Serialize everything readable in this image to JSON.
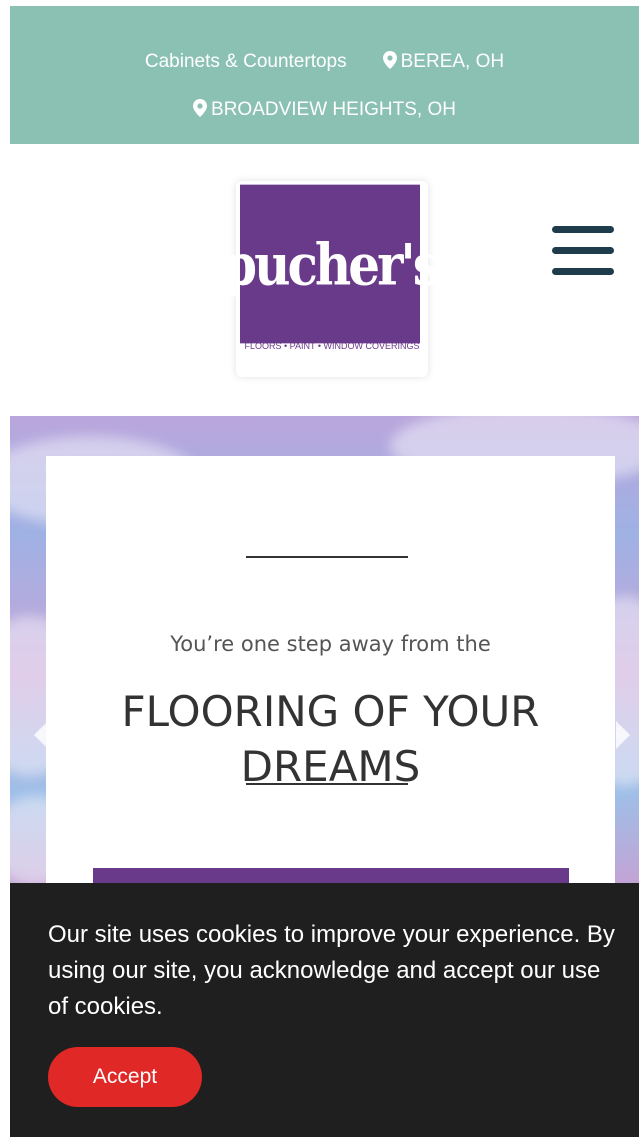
{
  "topbar": {
    "service_link": "Cabinets & Countertops",
    "location1": "BEREA, OH",
    "location2": "BROADVIEW HEIGHTS, OH",
    "background_color": "#8ac1b2"
  },
  "header": {
    "logo_text": "pucher's",
    "logo_tagline": "FLOORS • PAINT • WINDOW COVERINGS",
    "brand_color": "#6a3a8a",
    "menu_icon": "hamburger-menu-icon"
  },
  "hero": {
    "subtitle": "You’re one step away from the",
    "title": "FLOORING OF YOUR DREAMS",
    "prev_icon": "chevron-left-icon",
    "next_icon": "chevron-right-icon"
  },
  "cookie_banner": {
    "message": "Our site uses cookies to improve your experience. By using our site, you acknowledge and accept our use of cookies.",
    "accept_label": "Accept",
    "accept_color": "#e02826"
  }
}
